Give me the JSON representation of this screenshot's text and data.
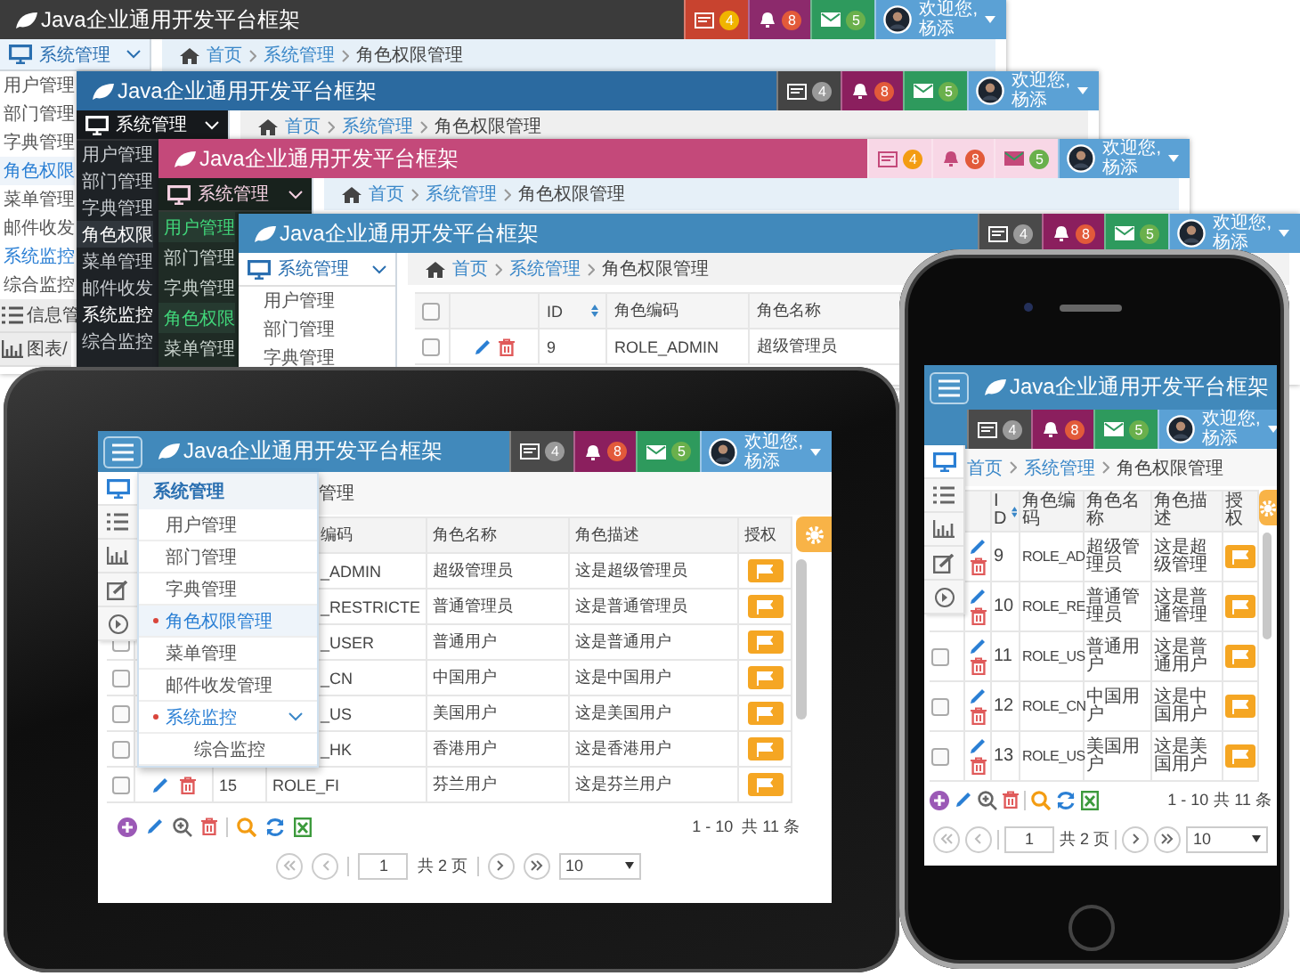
{
  "stacked_windows": [
    {
      "title": "Java企业通用开发平台框架",
      "notifications": [
        {
          "kind": "tasks",
          "count": "4"
        },
        {
          "kind": "alerts",
          "count": "8"
        },
        {
          "kind": "messages",
          "count": "5"
        }
      ],
      "user": {
        "greeting": "欢迎您,",
        "name": "杨添"
      },
      "menu_title": "系统管理",
      "menu": [
        {
          "label": "用户管理",
          "selected": false
        },
        {
          "label": "部门管理",
          "selected": false
        },
        {
          "label": "字典管理",
          "selected": false
        },
        {
          "label": "角色权限",
          "selected": true
        },
        {
          "label": "菜单管理",
          "selected": false
        },
        {
          "label": "邮件收发",
          "selected": false
        },
        {
          "label": "系统监控",
          "selected": false,
          "expanded": true,
          "children": [
            {
              "label": "综合监控",
              "selected": false
            }
          ]
        }
      ],
      "sections": [
        "信息管",
        "图表/"
      ],
      "breadcrumb": [
        "首页",
        "系统管理",
        "角色权限管理"
      ]
    },
    {
      "title": "Java企业通用开发平台框架",
      "notifications": [
        {
          "kind": "tasks",
          "count": "4"
        },
        {
          "kind": "alerts",
          "count": "8"
        },
        {
          "kind": "messages",
          "count": "5"
        }
      ],
      "user": {
        "greeting": "欢迎您,",
        "name": "杨添"
      },
      "menu_title": "系统管理",
      "menu": [
        {
          "label": "用户管理",
          "selected": false
        },
        {
          "label": "部门管理",
          "selected": false
        },
        {
          "label": "字典管理",
          "selected": false
        },
        {
          "label": "角色权限",
          "selected": true
        },
        {
          "label": "菜单管理",
          "selected": false
        },
        {
          "label": "邮件收发",
          "selected": false
        },
        {
          "label": "系统监控",
          "selected": false,
          "expanded": true,
          "children": [
            {
              "label": "综合监控",
              "selected": false
            }
          ]
        }
      ],
      "breadcrumb": [
        "首页",
        "系统管理",
        "角色权限管理"
      ]
    },
    {
      "title": "Java企业通用开发平台框架",
      "notifications": [
        {
          "kind": "tasks",
          "count": "4"
        },
        {
          "kind": "alerts",
          "count": "8"
        },
        {
          "kind": "messages",
          "count": "5"
        }
      ],
      "user": {
        "greeting": "欢迎您,",
        "name": "杨添"
      },
      "menu_title": "系统管理",
      "menu": [
        {
          "label": "用户管理",
          "selected": true
        },
        {
          "label": "部门管理",
          "selected": false
        },
        {
          "label": "字典管理",
          "selected": false
        },
        {
          "label": "角色权限",
          "selected": true
        },
        {
          "label": "菜单管理",
          "selected": false
        }
      ],
      "breadcrumb": [
        "首页",
        "系统管理",
        "角色权限管理"
      ]
    },
    {
      "title": "Java企业通用开发平台框架",
      "notifications": [
        {
          "kind": "tasks",
          "count": "4"
        },
        {
          "kind": "alerts",
          "count": "8"
        },
        {
          "kind": "messages",
          "count": "5"
        }
      ],
      "user": {
        "greeting": "欢迎您,",
        "name": "杨添"
      },
      "menu_title": "系统管理",
      "menu": [
        {
          "label": "用户管理",
          "selected": false
        },
        {
          "label": "部门管理",
          "selected": false
        },
        {
          "label": "字典管理",
          "selected": false
        }
      ],
      "breadcrumb": [
        "首页",
        "系统管理",
        "角色权限管理"
      ],
      "table": {
        "all_checked": false,
        "columns": [
          "ID",
          "角色编码",
          "角色名称"
        ],
        "rows": [
          {
            "checked": false,
            "id": "9",
            "code": "ROLE_ADMIN",
            "name": "超级管理员"
          }
        ]
      }
    }
  ],
  "tablet": {
    "title": "Java企业通用开发平台框架",
    "notifications": [
      {
        "kind": "tasks",
        "count": "4"
      },
      {
        "kind": "alerts",
        "count": "8"
      },
      {
        "kind": "messages",
        "count": "5"
      }
    ],
    "user": {
      "greeting": "欢迎您,",
      "name": "杨添"
    },
    "rail": [
      {
        "selected": true
      },
      {
        "selected": false
      },
      {
        "selected": false
      },
      {
        "selected": false
      },
      {
        "selected": false
      }
    ],
    "flyout": {
      "title": "系统管理",
      "items": [
        {
          "label": "用户管理",
          "selected": false
        },
        {
          "label": "部门管理",
          "selected": false
        },
        {
          "label": "字典管理",
          "selected": false
        },
        {
          "label": "角色权限管理",
          "selected": true
        },
        {
          "label": "菜单管理",
          "selected": false
        },
        {
          "label": "邮件收发管理",
          "selected": false
        },
        {
          "label": "系统监控",
          "selected": false,
          "expanded": true,
          "children": [
            {
              "label": "综合监控",
              "selected": false
            }
          ]
        }
      ]
    },
    "breadcrumb_tail": "管理",
    "table": {
      "columns": [
        "编码",
        "角色名称",
        "角色描述",
        "授权"
      ],
      "rows": [
        {
          "code": "_ADMIN",
          "name": "超级管理员",
          "desc": "这是超级管理员"
        },
        {
          "code": "_RESTRICTE",
          "name": "普通管理员",
          "desc": "这是普通管理员"
        },
        {
          "checked": false,
          "code": "_USER",
          "name": "普通用户",
          "desc": "这是普通用户"
        },
        {
          "checked": false,
          "code": "_CN",
          "name": "中国用户",
          "desc": "这是中国用户"
        },
        {
          "checked": false,
          "code": "_US",
          "name": "美国用户",
          "desc": "这是美国用户"
        },
        {
          "checked": false,
          "code": "_HK",
          "name": "香港用户",
          "desc": "这是香港用户"
        },
        {
          "checked": false,
          "id": "15",
          "code": "ROLE_FI",
          "name": "芬兰用户",
          "desc": "这是芬兰用户"
        }
      ]
    },
    "pager": {
      "range": "1 - 10",
      "total": "共 11 条",
      "page": "1",
      "pages": "共 2 页",
      "page_size": "10"
    }
  },
  "phone": {
    "title": "Java企业通用开发平台框架",
    "notifications": [
      {
        "kind": "tasks",
        "count": "4"
      },
      {
        "kind": "alerts",
        "count": "8"
      },
      {
        "kind": "messages",
        "count": "5"
      }
    ],
    "user": {
      "greeting": "欢迎您,",
      "name": "杨添"
    },
    "rail": [
      {
        "selected": true
      },
      {
        "selected": false
      },
      {
        "selected": false
      },
      {
        "selected": false
      },
      {
        "selected": false
      }
    ],
    "breadcrumb": [
      "首页",
      "系统管理",
      "角色权限管理"
    ],
    "table": {
      "columns": [
        "ID",
        "角色编码",
        "角色名称",
        "角色描述",
        "授权"
      ],
      "rows": [
        {
          "id": "9",
          "code": "ROLE_AD",
          "name": "超级管理员",
          "desc": "这是超级管理"
        },
        {
          "id": "10",
          "code": "ROLE_RE",
          "name": "普通管理员",
          "desc": "这是普通管理"
        },
        {
          "checked": false,
          "id": "11",
          "code": "ROLE_US",
          "name": "普通用户",
          "desc": "这是普通用户"
        },
        {
          "checked": false,
          "id": "12",
          "code": "ROLE_CN",
          "name": "中国用户",
          "desc": "这是中国用户"
        },
        {
          "checked": false,
          "id": "13",
          "code": "ROLE_US",
          "name": "美国用户",
          "desc": "这是美国用户"
        }
      ]
    },
    "pager": {
      "range": "1 - 10",
      "total": "共 11 条",
      "page": "1",
      "pages": "共 2 页",
      "page_size": "10"
    }
  }
}
